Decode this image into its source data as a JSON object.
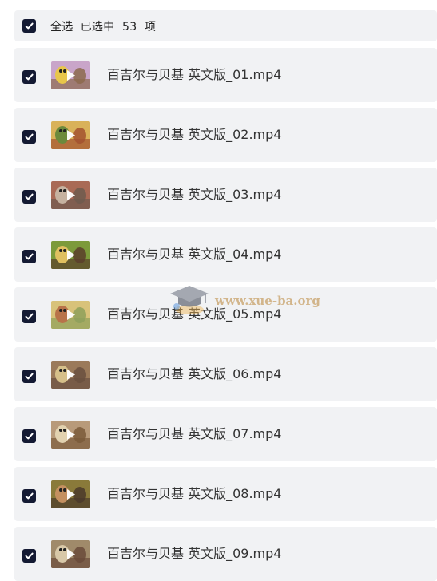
{
  "select_bar": {
    "select_all_label": "全选",
    "selected_text": "已选中  53  项",
    "checked": true
  },
  "files": [
    {
      "name": "百吉尔与贝基 英文版_01.mp4",
      "checked": true,
      "thumb_colors": [
        "#c9a5c9",
        "#e8c64a",
        "#8c6a4e"
      ]
    },
    {
      "name": "百吉尔与贝基 英文版_02.mp4",
      "checked": true,
      "thumb_colors": [
        "#d9b25a",
        "#6c8a3c",
        "#a2522f"
      ]
    },
    {
      "name": "百吉尔与贝基 英文版_03.mp4",
      "checked": true,
      "thumb_colors": [
        "#a96a56",
        "#c6b2a0",
        "#6f5a4e"
      ]
    },
    {
      "name": "百吉尔与贝基 英文版_04.mp4",
      "checked": true,
      "thumb_colors": [
        "#7c9a3a",
        "#e0c060",
        "#5a3e2a"
      ]
    },
    {
      "name": "百吉尔与贝基 英文版_05.mp4",
      "checked": true,
      "thumb_colors": [
        "#d8c27a",
        "#b8734a",
        "#8ea05a"
      ]
    },
    {
      "name": "百吉尔与贝基 英文版_06.mp4",
      "checked": true,
      "thumb_colors": [
        "#9b7a5a",
        "#d6c08a",
        "#6a5040"
      ]
    },
    {
      "name": "百吉尔与贝基 英文版_07.mp4",
      "checked": true,
      "thumb_colors": [
        "#b89a7a",
        "#e2d2b0",
        "#7a5a3a"
      ]
    },
    {
      "name": "百吉尔与贝基 英文版_08.mp4",
      "checked": true,
      "thumb_colors": [
        "#8a7a3a",
        "#c49060",
        "#4a3a2a"
      ]
    },
    {
      "name": "百吉尔与贝基 英文版_09.mp4",
      "checked": true,
      "thumb_colors": [
        "#a08a6a",
        "#d8c8a8",
        "#6a4a3a"
      ]
    }
  ],
  "watermark": {
    "text": "www.xue-ba.org",
    "icon": "graduation-cap-icon"
  },
  "colors": {
    "row_background": "#f1f2f4",
    "checkbox": "#141a33",
    "text": "#333333"
  }
}
